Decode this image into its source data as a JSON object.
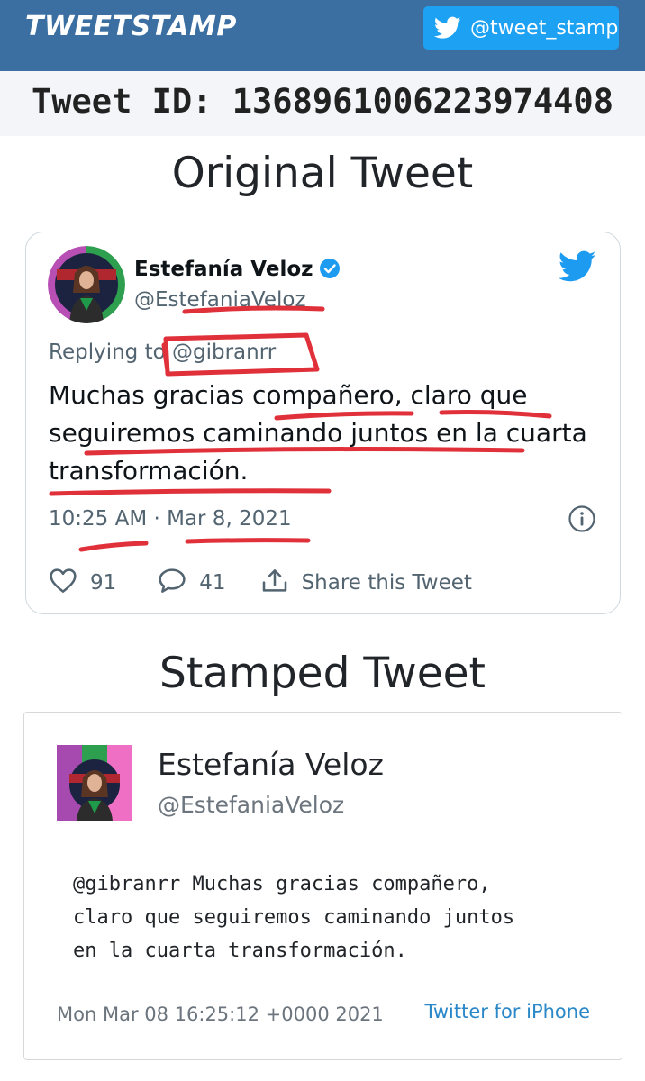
{
  "header": {
    "brand": "TWEETSTAMP",
    "twitter_button_label": "@tweet_stamp",
    "twitter_icon": "twitter-bird-icon"
  },
  "tweet_id_bar": {
    "text": "Tweet ID: 1368961006223974408"
  },
  "original_section": {
    "title": "Original Tweet",
    "card": {
      "author_name": "Estefanía Veloz",
      "verified_icon": "verified-badge-icon",
      "handle": "@EstefaniaVeloz",
      "corner_icon": "twitter-bird-icon",
      "replying_prefix": "Replying to",
      "replying_handle": "@gibranrr",
      "text": "Muchas gracias compañero, claro que seguiremos caminando juntos en la cuarta transformación.",
      "timestamp": "10:25 AM · Mar 8, 2021",
      "info_icon": "info-icon",
      "likes": "91",
      "replies": "41",
      "share_label": "Share this Tweet",
      "annotation_color": "#e0303a"
    }
  },
  "stamped_section": {
    "title": "Stamped Tweet",
    "card": {
      "author_name": "Estefanía Veloz",
      "handle": "@EstefaniaVeloz",
      "text": "@gibranrr Muchas gracias compañero,\nclaro que seguiremos caminando juntos\nen la cuarta transformación.",
      "stamp_date": "Mon Mar 08 16:25:12 +0000 2021",
      "source": "Twitter for iPhone"
    }
  },
  "colors": {
    "nav_bg": "#3b6fa2",
    "twitter_blue": "#1da1f2",
    "id_bar_bg": "#f3f5f8",
    "link": "#2a88c9"
  }
}
